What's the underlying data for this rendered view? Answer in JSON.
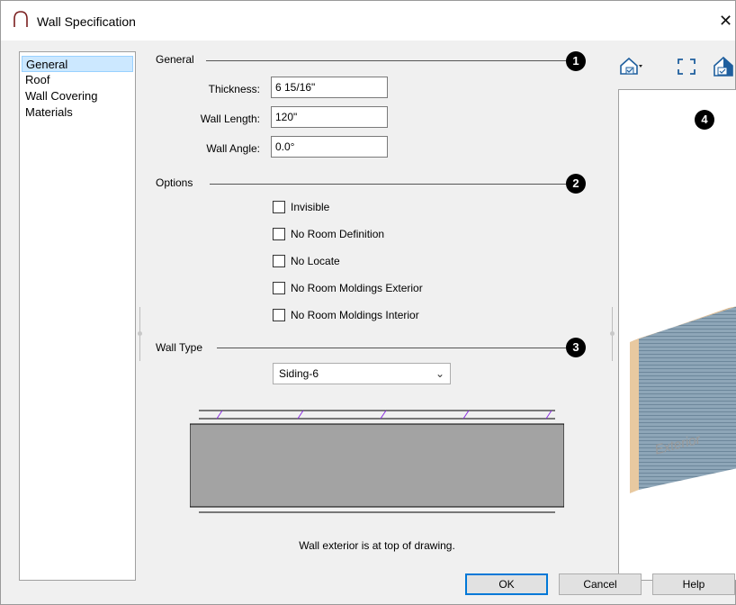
{
  "window": {
    "title": "Wall Specification",
    "close_glyph": "✕"
  },
  "nav": {
    "items": [
      {
        "label": "General",
        "selected": true
      },
      {
        "label": "Roof",
        "selected": false
      },
      {
        "label": "Wall Covering",
        "selected": false
      },
      {
        "label": "Materials",
        "selected": false
      }
    ]
  },
  "general": {
    "heading": "General",
    "badge": "1",
    "fields": [
      {
        "label": "Thickness:",
        "value": "6 15/16\""
      },
      {
        "label": "Wall Length:",
        "value": "120\""
      },
      {
        "label": "Wall Angle:",
        "value": "0.0°"
      }
    ]
  },
  "options": {
    "heading": "Options",
    "badge": "2",
    "checkboxes": [
      {
        "label": "Invisible",
        "checked": false
      },
      {
        "label": "No Room Definition",
        "checked": false
      },
      {
        "label": "No Locate",
        "checked": false
      },
      {
        "label": "No Room Moldings Exterior",
        "checked": false
      },
      {
        "label": "No Room Moldings Interior",
        "checked": false
      }
    ]
  },
  "wall_type": {
    "heading": "Wall Type",
    "badge": "3",
    "selected": "Siding-6",
    "caption": "Wall exterior is at top of drawing."
  },
  "preview": {
    "badge": "4",
    "exterior_label": "Exterior",
    "toolbar_icons": [
      "render-options-icon",
      "fit-to-window-icon",
      "view-settings-icon"
    ]
  },
  "buttons": {
    "ok": "OK",
    "cancel": "Cancel",
    "help": "Help"
  },
  "colors": {
    "selection": "#cce8ff",
    "wall_fill": "#a3a3a3",
    "siding_hatch": "#8a2be2",
    "siding_blue": "#7f9aae",
    "wall_edge_tan": "#e8c9a0",
    "ok_border": "#0078d7"
  }
}
